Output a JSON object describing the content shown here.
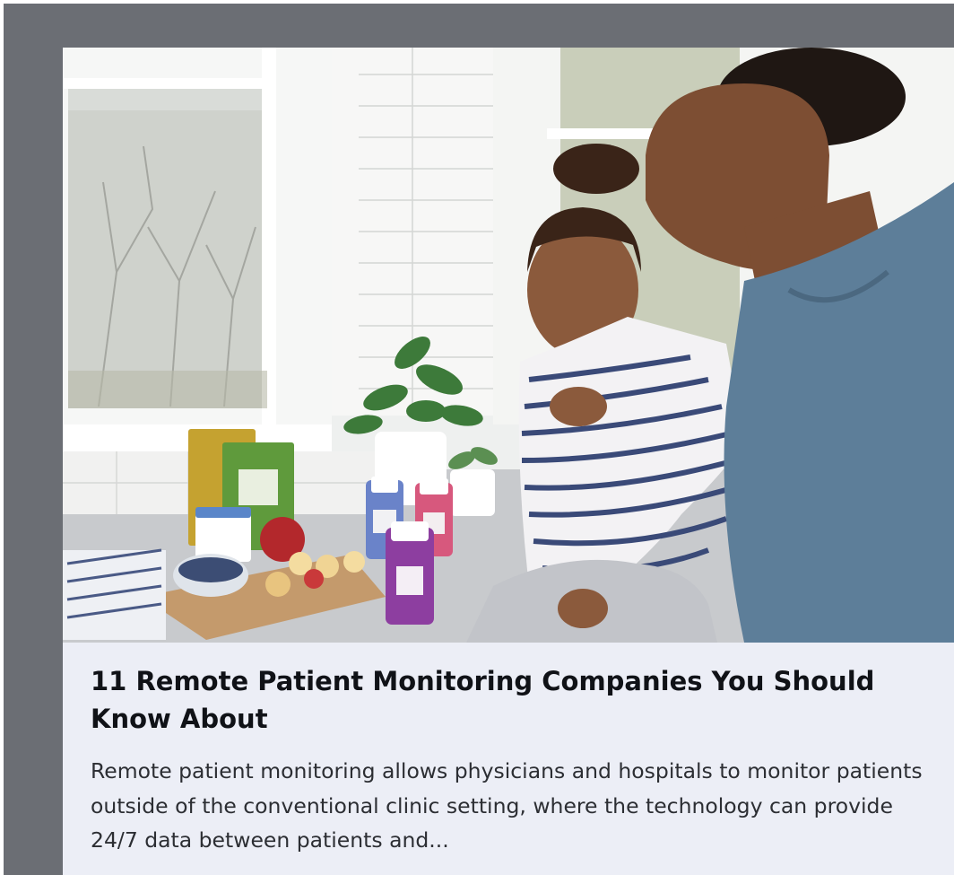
{
  "article": {
    "title": "11 Remote Patient Monitoring Companies You Should Know About",
    "excerpt": "Remote patient monitoring allows physicians and hospitals to monitor patients outside of the conventional clinic setting, where the technology can provide 24/7 data between patients and...",
    "image_subject": "girl laughing with woman in a kitchen with supplement bottles"
  },
  "colors": {
    "backdrop": "#6b6e74",
    "card_background": "#eceef6",
    "title_text": "#101217",
    "body_text": "#2c2e33"
  }
}
